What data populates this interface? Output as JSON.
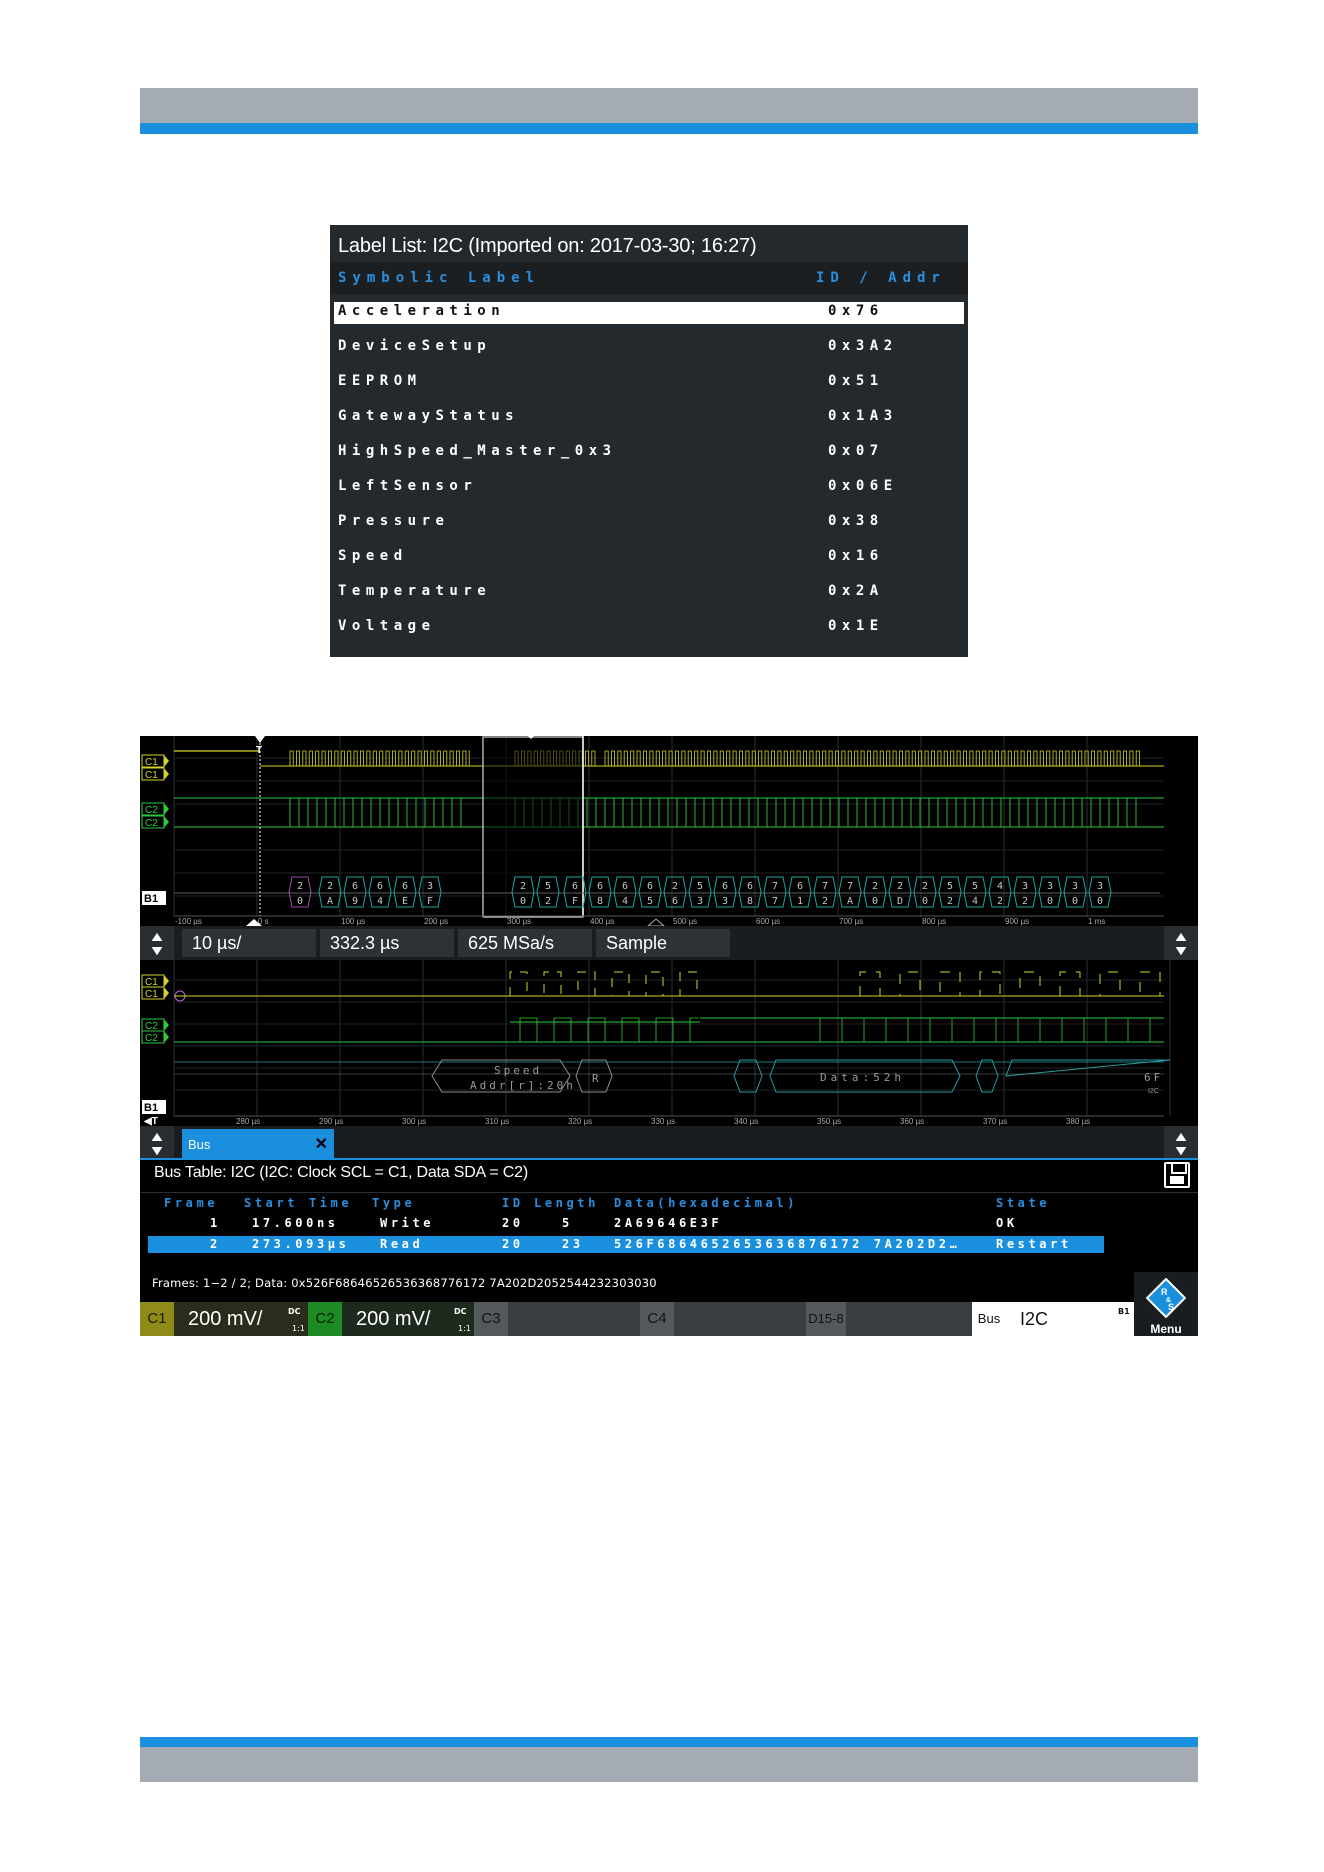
{
  "label_list": {
    "title": "Label List: I2C (Imported on: 2017-03-30; 16:27)",
    "col_label": "Symbolic Label",
    "col_id": "ID / Addr",
    "rows": [
      {
        "label": "Acceleration",
        "id": "0x76",
        "selected": true
      },
      {
        "label": "DeviceSetup",
        "id": "0x3A2"
      },
      {
        "label": "EEPROM",
        "id": "0x51"
      },
      {
        "label": "GatewayStatus",
        "id": "0x1A3"
      },
      {
        "label": "HighSpeed_Master_0x3",
        "id": "0x07"
      },
      {
        "label": "LeftSensor",
        "id": "0x06E"
      },
      {
        "label": "Pressure",
        "id": "0x38"
      },
      {
        "label": "Speed",
        "id": "0x16"
      },
      {
        "label": "Temperature",
        "id": "0x2A"
      },
      {
        "label": "Voltage",
        "id": "0x1E"
      }
    ]
  },
  "overview": {
    "trigger_label": "T",
    "channel_labels": [
      "C1",
      "C1",
      "C2",
      "C2",
      "B1"
    ],
    "time_ticks": [
      "-100 µs",
      "0 s",
      "100 µs",
      "200 µs",
      "300 µs",
      "400 µs",
      "500 µs",
      "600 µs",
      "700 µs",
      "800 µs",
      "900 µs",
      "1 ms"
    ],
    "bus_digits_top": [
      "2",
      "2",
      "6",
      "6",
      "6",
      "3",
      "2",
      "5",
      "6",
      "6",
      "6",
      "6",
      "2",
      "5",
      "6",
      "6",
      "7",
      "6",
      "7",
      "7",
      "2",
      "2",
      "2",
      "5",
      "5",
      "4",
      "3",
      "3",
      "3",
      "3"
    ],
    "bus_digits_bot": [
      "0",
      "A",
      "9",
      "4",
      "E",
      "F",
      "0",
      "2",
      "F",
      "8",
      "4",
      "5",
      "6",
      "3",
      "3",
      "8",
      "7",
      "1",
      "2",
      "A",
      "0",
      "D",
      "0",
      "2",
      "4",
      "2",
      "2",
      "0",
      "0",
      "0"
    ]
  },
  "timebase": {
    "scale": "10 µs/",
    "position": "332.3 µs",
    "sample_rate": "625 MSa/s",
    "mode": "Sample"
  },
  "zoom": {
    "channel_labels": [
      "C1",
      "C1",
      "C2",
      "C2",
      "B1"
    ],
    "trigger_label": "T",
    "time_ticks": [
      "280 µs",
      "290 µs",
      "300 µs",
      "310 µs",
      "320 µs",
      "330 µs",
      "340 µs",
      "350 µs",
      "360 µs",
      "370 µs",
      "380 µs"
    ],
    "decode_speed": "Speed",
    "decode_addr": "Addr[r]:20h",
    "decode_r": "R",
    "decode_data": "Data:52h",
    "decode_tail": "6F",
    "decode_bus": "I2C"
  },
  "bus_tab": {
    "label": "Bus",
    "close": "✕"
  },
  "bus_table": {
    "title": "Bus Table: I2C (I2C: Clock SCL = C1, Data SDA = C2)",
    "headers": {
      "frame": "Frame",
      "start": "Start Time",
      "type": "Type",
      "id": "ID",
      "length": "Length",
      "data": "Data(hexadecimal)",
      "state": "State"
    },
    "rows": [
      {
        "frame": "1",
        "start": "17.600ns",
        "type": "Write",
        "id": "20",
        "length": "5",
        "data": "2A69646E3F",
        "state": "OK",
        "selected": false
      },
      {
        "frame": "2",
        "start": "273.093µs",
        "type": "Read",
        "id": "20",
        "length": "23",
        "data": "526F6864652653636876172 7A202D2…",
        "state": "Restart",
        "selected": true
      }
    ],
    "footer": "Frames: 1−2 / 2; Data: 0x526F68646526536368776172 7A202D2052544232303030"
  },
  "channels": {
    "c1": {
      "tag": "C1",
      "value": "200 mV/",
      "coupling": "DC",
      "ratio": "1:1"
    },
    "c2": {
      "tag": "C2",
      "value": "200 mV/",
      "coupling": "DC",
      "ratio": "1:1"
    },
    "c3": {
      "tag": "C3"
    },
    "c4": {
      "tag": "C4"
    },
    "digital": {
      "tag": "D15-8"
    },
    "bus": {
      "tag": "Bus",
      "value": "I2C",
      "id": "B1"
    }
  },
  "menu_label": "Menu",
  "colors": {
    "c1": "#d4d22a",
    "c2": "#2fc93b",
    "bus": "#19a7a0",
    "accent": "#1a8fdd"
  }
}
